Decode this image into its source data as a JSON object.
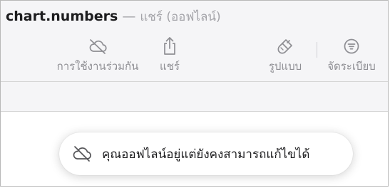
{
  "document": {
    "name": "chart.numbers",
    "separator": "—",
    "status": "แชร์ (ออฟไลน์)"
  },
  "toolbar": {
    "collaborate": {
      "label": "การใช้งานร่วมกัน",
      "icon": "cloud-offline-icon"
    },
    "share": {
      "label": "แชร์",
      "icon": "share-icon"
    },
    "format": {
      "label": "รูปแบบ",
      "icon": "paintbrush-icon"
    },
    "organize": {
      "label": "จัดระเบียบ",
      "icon": "organize-filter-icon"
    }
  },
  "toast": {
    "icon": "cloud-offline-icon",
    "message": "คุณออฟไลน์อยู่แต่ยังคงสามารถแก้ไขได้"
  },
  "colors": {
    "toolbar_background": "#f5f5f7",
    "icon_gray": "#8e8e93",
    "title_gray": "#a3a3a8",
    "text_dark": "#1d1d1f"
  }
}
